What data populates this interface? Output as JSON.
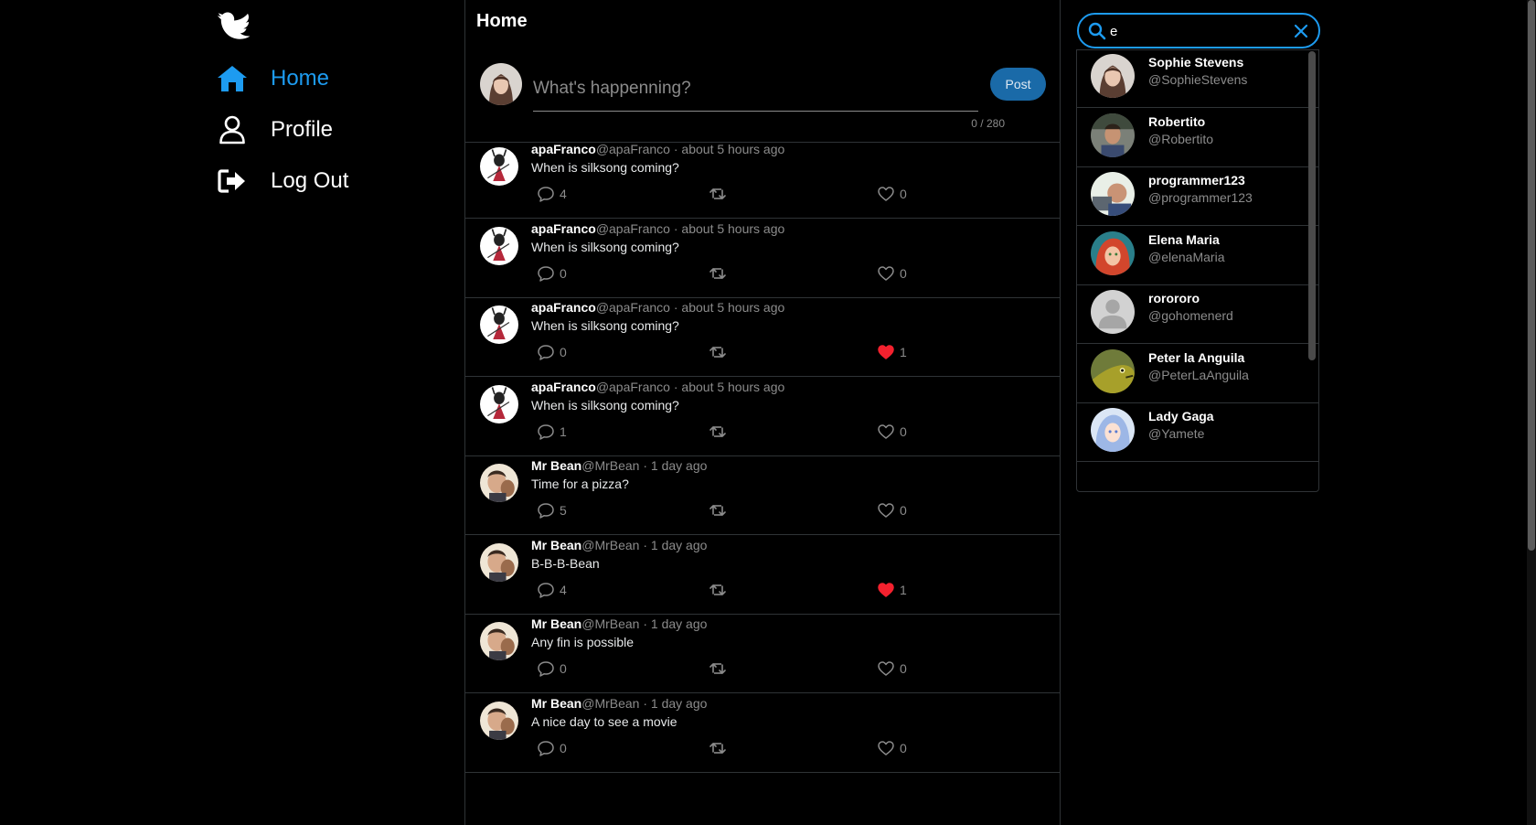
{
  "nav": {
    "home": "Home",
    "profile": "Profile",
    "logout": "Log Out"
  },
  "feed": {
    "title": "Home",
    "composer": {
      "placeholder": "What's happenning?",
      "post_label": "Post",
      "char_count": "0 / 280"
    },
    "tweets": [
      {
        "name": "apaFranco",
        "handle": "@apaFranco",
        "dot": " · ",
        "time": "about 5 hours ago",
        "text": "When is silksong coming?",
        "replies": "4",
        "likes": "0",
        "liked": false
      },
      {
        "name": "apaFranco",
        "handle": "@apaFranco",
        "dot": " · ",
        "time": "about 5 hours ago",
        "text": "When is silksong coming?",
        "replies": "0",
        "likes": "0",
        "liked": false
      },
      {
        "name": "apaFranco",
        "handle": "@apaFranco",
        "dot": " · ",
        "time": "about 5 hours ago",
        "text": "When is silksong coming?",
        "replies": "0",
        "likes": "1",
        "liked": true
      },
      {
        "name": "apaFranco",
        "handle": "@apaFranco",
        "dot": " · ",
        "time": "about 5 hours ago",
        "text": "When is silksong coming?",
        "replies": "1",
        "likes": "0",
        "liked": false
      },
      {
        "name": "Mr Bean",
        "handle": "@MrBean",
        "dot": " · ",
        "time": "1 day ago",
        "text": "Time for a pizza?",
        "replies": "5",
        "likes": "0",
        "liked": false
      },
      {
        "name": "Mr Bean",
        "handle": "@MrBean",
        "dot": " · ",
        "time": "1 day ago",
        "text": "B-B-B-Bean",
        "replies": "4",
        "likes": "1",
        "liked": true
      },
      {
        "name": "Mr Bean",
        "handle": "@MrBean",
        "dot": " · ",
        "time": "1 day ago",
        "text": "Any fin is possible",
        "replies": "0",
        "likes": "0",
        "liked": false
      },
      {
        "name": "Mr Bean",
        "handle": "@MrBean",
        "dot": " · ",
        "time": "1 day ago",
        "text": "A nice day to see a movie",
        "replies": "0",
        "likes": "0",
        "liked": false
      }
    ]
  },
  "search": {
    "value": "e",
    "results": [
      {
        "name": "Sophie Stevens",
        "handle": "@SophieStevens"
      },
      {
        "name": "Robertito",
        "handle": "@Robertito"
      },
      {
        "name": "programmer123",
        "handle": "@programmer123"
      },
      {
        "name": "Elena Maria",
        "handle": "@elenaMaria"
      },
      {
        "name": "rorororo",
        "handle": "@gohomenerd"
      },
      {
        "name": "Peter la Anguila",
        "handle": "@PeterLaAnguila"
      },
      {
        "name": "Lady Gaga",
        "handle": "@Yamete"
      }
    ]
  },
  "colors": {
    "accent": "#1d9bf0",
    "post_button": "#1a6aa8",
    "like_active": "#f4212e",
    "muted": "#8b8b8b",
    "border": "#2f3336"
  },
  "icons": {
    "logo": "bird-icon",
    "home": "house-icon",
    "profile": "user-outline-icon",
    "logout": "sign-out-icon",
    "reply": "speech-bubble-icon",
    "retweet": "retweet-icon",
    "like": "heart-icon",
    "search": "magnifier-icon",
    "clear": "x-icon"
  }
}
